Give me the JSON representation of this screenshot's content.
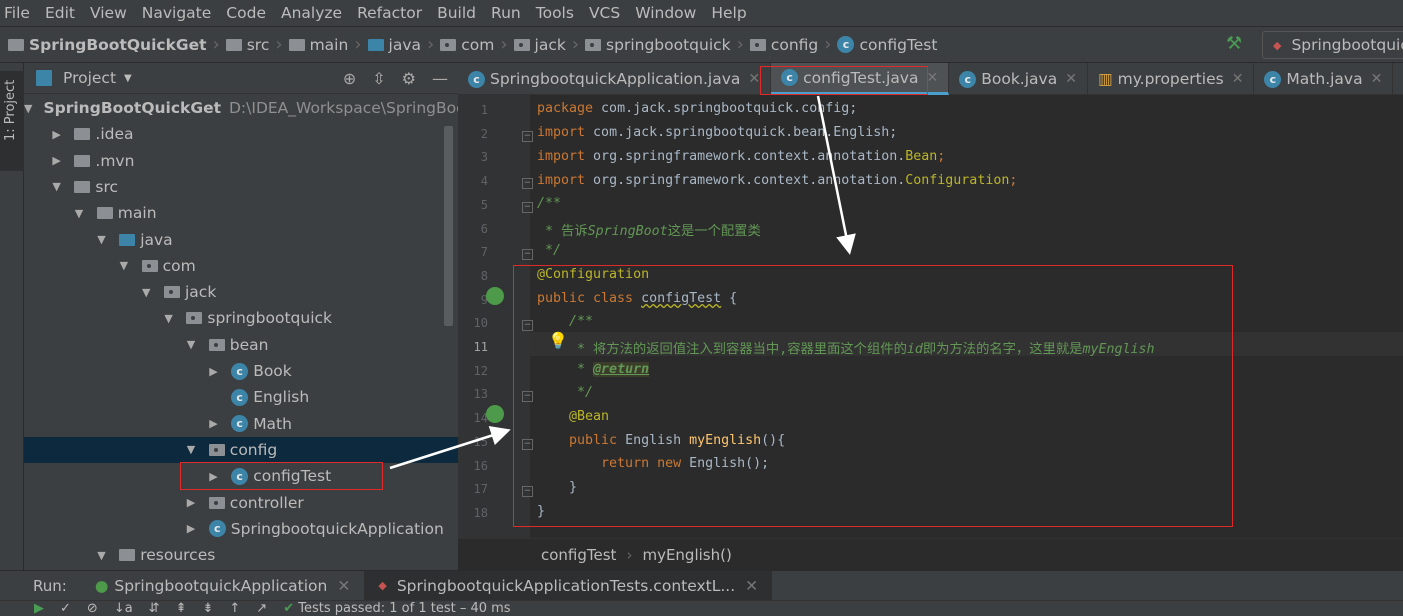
{
  "menu": [
    "File",
    "Edit",
    "View",
    "Navigate",
    "Code",
    "Analyze",
    "Refactor",
    "Build",
    "Run",
    "Tools",
    "VCS",
    "Window",
    "Help"
  ],
  "breadcrumb": [
    "SpringBootQuickGet",
    "src",
    "main",
    "java",
    "com",
    "jack",
    "springbootquick",
    "config",
    "configTest"
  ],
  "run_config": "Springbootquic",
  "side_tab": "1: Project",
  "project": {
    "title": "Project",
    "root_path": "D:\\IDEA_Workspace\\SpringBoo",
    "tree": [
      {
        "label": "SpringBootQuickGet",
        "level": 0,
        "open": true
      },
      {
        "label": ".idea",
        "level": 1,
        "open": false
      },
      {
        "label": ".mvn",
        "level": 1,
        "open": false
      },
      {
        "label": "src",
        "level": 1,
        "open": true
      },
      {
        "label": "main",
        "level": 2,
        "open": true
      },
      {
        "label": "java",
        "level": 3,
        "open": true
      },
      {
        "label": "com",
        "level": 4,
        "open": true
      },
      {
        "label": "jack",
        "level": 5,
        "open": true
      },
      {
        "label": "springbootquick",
        "level": 6,
        "open": true
      },
      {
        "label": "bean",
        "level": 7,
        "open": true
      },
      {
        "label": "Book",
        "level": 8,
        "open": false
      },
      {
        "label": "English",
        "level": 8
      },
      {
        "label": "Math",
        "level": 8,
        "open": false
      },
      {
        "label": "config",
        "level": 7,
        "open": true,
        "selected": true
      },
      {
        "label": "configTest",
        "level": 8,
        "open": false
      },
      {
        "label": "controller",
        "level": 7,
        "open": false
      },
      {
        "label": "SpringbootquickApplication",
        "level": 7,
        "open": false
      },
      {
        "label": "resources",
        "level": 3,
        "open": true
      }
    ]
  },
  "tabs": [
    {
      "label": "SpringbootquickApplication.java"
    },
    {
      "label": "configTest.java",
      "active": true
    },
    {
      "label": "Book.java"
    },
    {
      "label": "my.properties"
    },
    {
      "label": "Math.java"
    },
    {
      "label": "S"
    }
  ],
  "code": {
    "l1": {
      "kw": "package",
      "rest": " com.jack.springbootquick.config;"
    },
    "l2": {
      "kw": "import",
      "rest": " com.jack.springbootquick.bean.English;"
    },
    "l3": {
      "kw": "import",
      "rest": " org.springframework.context.annotation.",
      "cls": "Bean",
      ";": ";"
    },
    "l4": {
      "kw": "import",
      "rest": " org.springframework.context.annotation.",
      "cls": "Configuration"
    },
    "l5": "/**",
    "l6a": " * 告诉",
    "l6b": "SpringBoot",
    "l6c": "这是一个配置类",
    "l7": " */",
    "l8": "@Configuration",
    "l9a": "public class ",
    "l9b": "configTest",
    " l9c": " {",
    "l10": "    /**",
    "l11a": "     * 将方法的返回值注入到容器当中,容器里面这个组件的",
    "l11b": "id",
    "l11c": "即为方法的名字，这里就是",
    "l11d": "myEnglish",
    "l12a": "     * ",
    "l12b": "@return",
    "l13": "     */",
    "l14": "    @Bean",
    "l15a": "    public ",
    "l15b": "English ",
    "l15c": "myEnglish",
    "l15d": "(){",
    "l16a": "        return new ",
    "l16b": "English();",
    "l17": "    }",
    "l18": "}"
  },
  "editor_breadcrumb": [
    "configTest",
    "myEnglish()"
  ],
  "run": {
    "label": "Run:",
    "tabs": [
      "SpringbootquickApplication",
      "SpringbootquickApplicationTests.contextL..."
    ],
    "status": "Tests passed: 1 of 1 test – 40 ms"
  },
  "colors": {
    "keyword": "#cc7832",
    "annotation": "#bbb529",
    "comment": "#629755",
    "highlight": "#e02a2a",
    "accent": "#3d85a8"
  }
}
